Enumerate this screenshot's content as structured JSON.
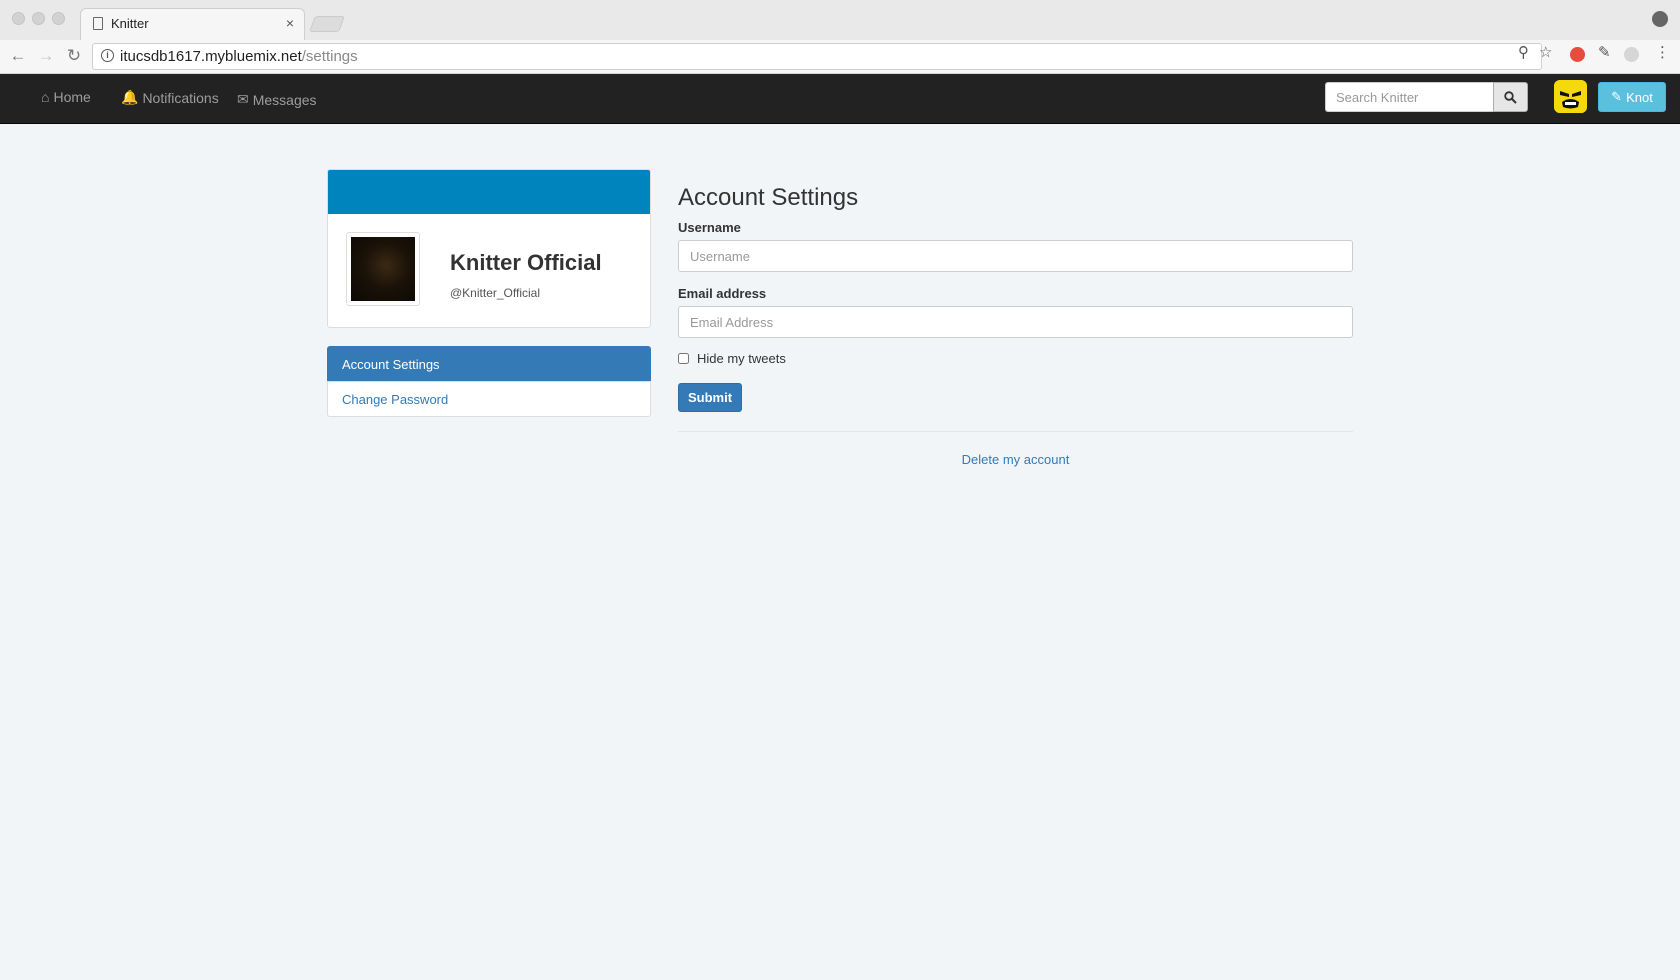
{
  "browser": {
    "tab_title": "Knitter",
    "tab_close": "×",
    "url_host": "itucsdb1617.mybluemix.net",
    "url_path": "/settings"
  },
  "navbar": {
    "home": "Home",
    "notifications": "Notifications",
    "messages": "Messages",
    "search_placeholder": "Search Knitter",
    "knot_label": "Knot"
  },
  "profile": {
    "name": "Knitter Official",
    "handle": "@Knitter_Official"
  },
  "sidebar": {
    "items": [
      {
        "label": "Account Settings"
      },
      {
        "label": "Change Password"
      }
    ]
  },
  "settings": {
    "title": "Account Settings",
    "username_label": "Username",
    "username_placeholder": "Username",
    "email_label": "Email address",
    "email_placeholder": "Email Address",
    "hide_tweets_label": "Hide my tweets",
    "submit_label": "Submit",
    "delete_label": "Delete my account"
  },
  "colors": {
    "navbar_bg": "#222222",
    "primary": "#337ab7",
    "banner": "#0084be",
    "knot": "#5bc0de"
  }
}
